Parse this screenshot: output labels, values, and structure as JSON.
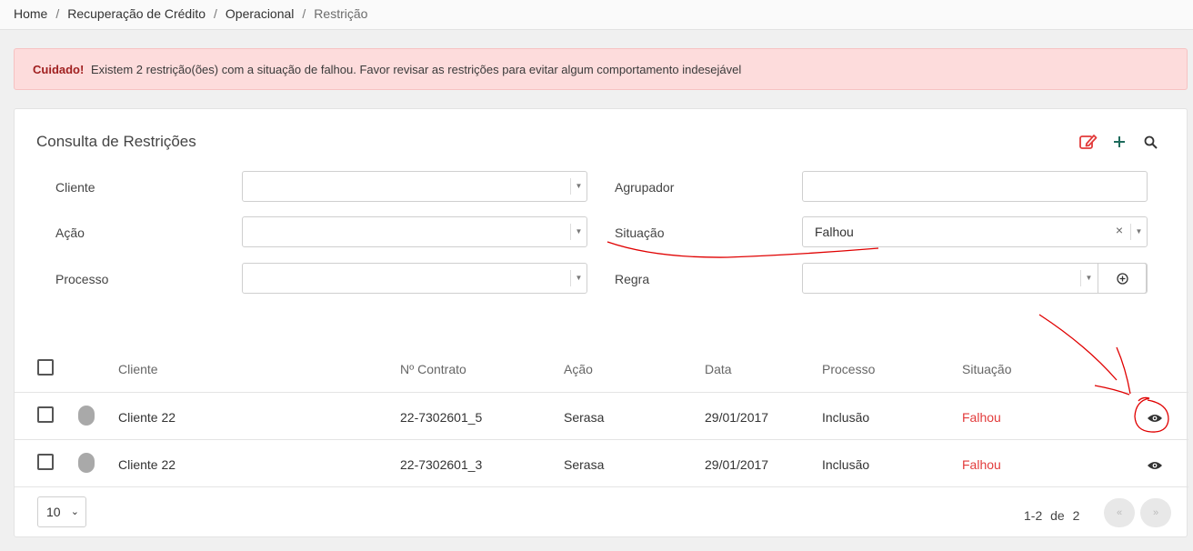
{
  "breadcrumb": {
    "items": [
      "Home",
      "Recuperação de Crédito",
      "Operacional"
    ],
    "current": "Restrição"
  },
  "alert": {
    "strong": "Cuidado!",
    "message": "Existem 2 restrição(ões) com a situação de falhou. Favor revisar as restrições para evitar algum comportamento indesejável"
  },
  "panel": {
    "title": "Consulta de Restrições"
  },
  "filters": {
    "cliente_label": "Cliente",
    "acao_label": "Ação",
    "processo_label": "Processo",
    "agrupador_label": "Agrupador",
    "situacao_label": "Situação",
    "situacao_value": "Falhou",
    "regra_label": "Regra"
  },
  "table": {
    "headers": [
      "Cliente",
      "Nº Contrato",
      "Ação",
      "Data",
      "Processo",
      "Situação"
    ],
    "rows": [
      {
        "cliente": "Cliente 22",
        "contrato": "22-7302601_5",
        "acao": "Serasa",
        "data": "29/01/2017",
        "processo": "Inclusão",
        "situacao": "Falhou"
      },
      {
        "cliente": "Cliente 22",
        "contrato": "22-7302601_3",
        "acao": "Serasa",
        "data": "29/01/2017",
        "processo": "Inclusão",
        "situacao": "Falhou"
      }
    ]
  },
  "pagination": {
    "page_size": "10",
    "range": "1-2",
    "of": "de",
    "total": "2",
    "prev": "«",
    "next": "»"
  },
  "icons": {
    "edit": "edit-icon",
    "add": "plus-icon",
    "search": "search-icon",
    "view": "eye-icon"
  },
  "colors": {
    "danger": "#e23b3b",
    "alert_bg": "#fddcdc",
    "annotation": "#e00000"
  }
}
